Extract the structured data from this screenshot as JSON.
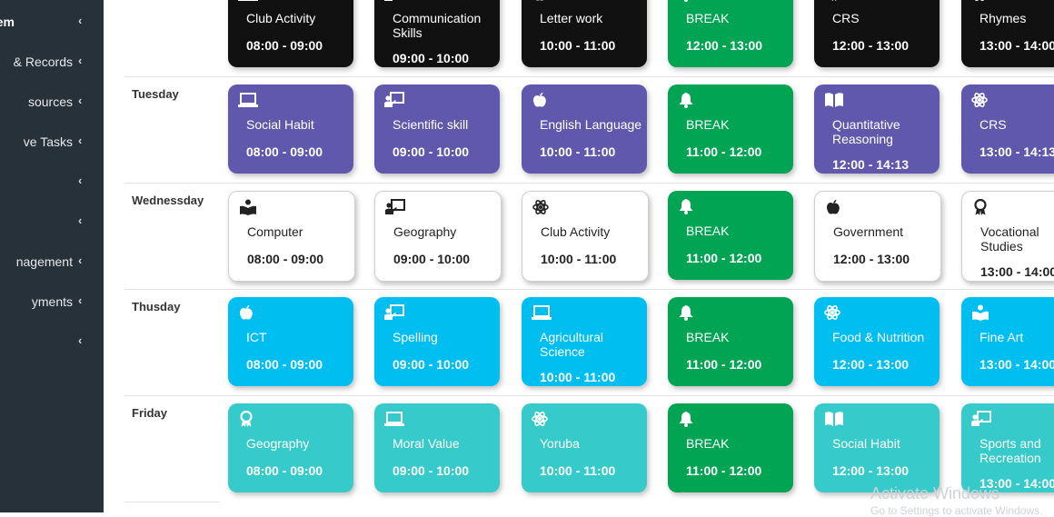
{
  "sidebar": {
    "items": [
      {
        "label": "em"
      },
      {
        "label": "& Records"
      },
      {
        "label": "sources"
      },
      {
        "label": "ve Tasks"
      },
      {
        "label": ""
      },
      {
        "label": ""
      },
      {
        "label": "nagement"
      },
      {
        "label": "yments"
      },
      {
        "label": ""
      }
    ],
    "chevron": "‹"
  },
  "timetable": {
    "days": [
      "",
      "Tuesday",
      "Wednessday",
      "Thusday",
      "Friday"
    ],
    "rows": [
      [
        {
          "subject": "Club Activity",
          "time": "08:00 - 09:00",
          "icon": "laptop-icon",
          "color": "black"
        },
        {
          "subject": "Communication Skills",
          "time": "09:00 - 10:00",
          "icon": "teacher-board-icon",
          "color": "black"
        },
        {
          "subject": "Letter work",
          "time": "10:00 - 11:00",
          "icon": "apple-icon",
          "color": "black"
        },
        {
          "subject": "BREAK",
          "time": "12:00 - 13:00",
          "icon": "bell-icon",
          "color": "green"
        },
        {
          "subject": "CRS",
          "time": "12:00 - 13:00",
          "icon": "book-icon",
          "color": "black"
        },
        {
          "subject": "Rhymes",
          "time": "13:00 - 14:00",
          "icon": "atom-icon",
          "color": "black"
        }
      ],
      [
        {
          "subject": "Social Habit",
          "time": "08:00 - 09:00",
          "icon": "laptop-icon",
          "color": "purple"
        },
        {
          "subject": "Scientific skill",
          "time": "09:00 - 10:00",
          "icon": "teacher-board-icon",
          "color": "purple"
        },
        {
          "subject": "English Language",
          "time": "10:00 - 11:00",
          "icon": "apple-icon",
          "color": "purple"
        },
        {
          "subject": "BREAK",
          "time": "11:00 - 12:00",
          "icon": "bell-icon",
          "color": "green"
        },
        {
          "subject": "Quantitative Reasoning",
          "time": "12:00 - 14:13",
          "icon": "book-icon",
          "color": "purple"
        },
        {
          "subject": "CRS",
          "time": "13:00 - 14:13",
          "icon": "atom-icon",
          "color": "purple"
        }
      ],
      [
        {
          "subject": "Computer",
          "time": "08:00 - 09:00",
          "icon": "reader-icon",
          "color": "white"
        },
        {
          "subject": "Geography",
          "time": "09:00 - 10:00",
          "icon": "teacher-board-icon",
          "color": "white"
        },
        {
          "subject": "Club Activity",
          "time": "10:00 - 11:00",
          "icon": "atom-icon",
          "color": "white"
        },
        {
          "subject": "BREAK",
          "time": "11:00 - 12:00",
          "icon": "bell-icon",
          "color": "green"
        },
        {
          "subject": "Government",
          "time": "12:00 - 13:00",
          "icon": "apple-icon",
          "color": "white"
        },
        {
          "subject": "Vocational Studies",
          "time": "13:00 - 14:00",
          "icon": "award-icon",
          "color": "white"
        }
      ],
      [
        {
          "subject": "ICT",
          "time": "08:00 - 09:00",
          "icon": "apple-icon",
          "color": "blue"
        },
        {
          "subject": "Spelling",
          "time": "09:00 - 10:00",
          "icon": "teacher-board-icon",
          "color": "blue"
        },
        {
          "subject": "Agricultural Science",
          "time": "10:00 - 11:00",
          "icon": "laptop-icon",
          "color": "blue"
        },
        {
          "subject": "BREAK",
          "time": "11:00 - 12:00",
          "icon": "bell-icon",
          "color": "green"
        },
        {
          "subject": "Food & Nutrition",
          "time": "12:00 - 13:00",
          "icon": "atom-icon",
          "color": "blue"
        },
        {
          "subject": "Fine Art",
          "time": "13:00 - 14:00",
          "icon": "reader-icon",
          "color": "blue"
        }
      ],
      [
        {
          "subject": "Geography",
          "time": "08:00 - 09:00",
          "icon": "award-icon",
          "color": "teal"
        },
        {
          "subject": "Moral Value",
          "time": "09:00 - 10:00",
          "icon": "laptop-icon",
          "color": "teal"
        },
        {
          "subject": "Yoruba",
          "time": "10:00 - 11:00",
          "icon": "atom-icon",
          "color": "teal"
        },
        {
          "subject": "BREAK",
          "time": "11:00 - 12:00",
          "icon": "bell-icon",
          "color": "green"
        },
        {
          "subject": "Social Habit",
          "time": "12:00 - 13:00",
          "icon": "book-icon",
          "color": "teal"
        },
        {
          "subject": "Sports and Recreation",
          "time": "13:00 - 14:00",
          "icon": "teacher-board-icon",
          "color": "teal"
        }
      ]
    ]
  },
  "watermark": {
    "line1": "Activate Windows",
    "line2": "Go to Settings to activate Windows."
  },
  "colors": {
    "sidebar_bg": "#27313a",
    "black": "#111111",
    "purple": "#6058ad",
    "green": "#00a453",
    "blue": "#00bff0",
    "teal": "#37cacb",
    "white": "#ffffff"
  }
}
